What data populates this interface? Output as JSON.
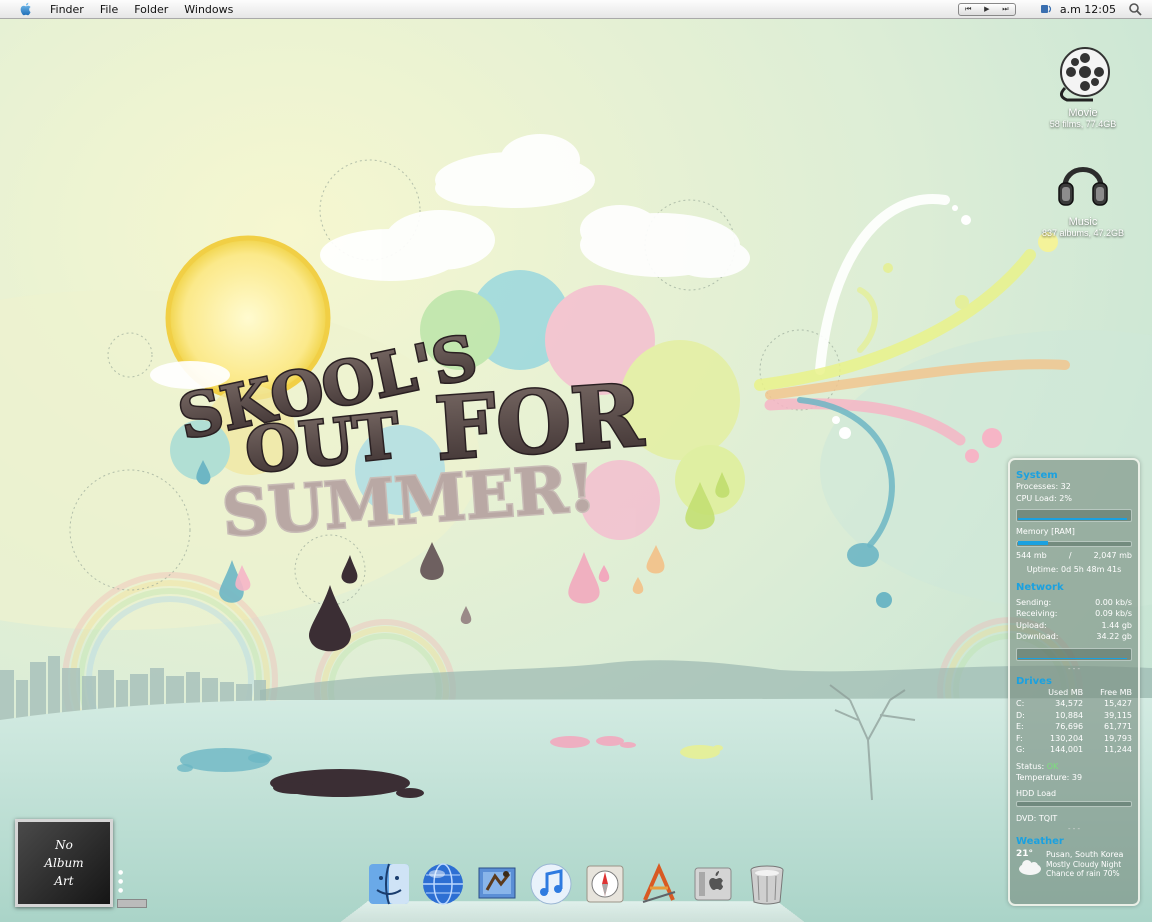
{
  "menubar": {
    "items": [
      "Finder",
      "File",
      "Folder",
      "Windows"
    ],
    "clock": "a.m 12:05",
    "media_controls": [
      "⏮",
      "▶",
      "⏭"
    ]
  },
  "desktop_icons": [
    {
      "label": "Movie",
      "sub": "58 films, 77.4GB",
      "icon": "film-reel-icon"
    },
    {
      "label": "Music",
      "sub": "837 albums, 47.2GB",
      "icon": "headphones-icon"
    }
  ],
  "wallpaper": {
    "words": [
      "SKOOL'S",
      "OUT",
      "FOR",
      "SUMMER!"
    ]
  },
  "sysmon": {
    "system": {
      "title": "System",
      "processes": "Processes: 32",
      "cpu": "CPU Load: 2%"
    },
    "memory": {
      "title": "Memory [RAM]",
      "used": "544 mb",
      "sep": "/",
      "total": "2,047 mb",
      "uptime": "Uptime: 0d 5h 48m 41s"
    },
    "network": {
      "title": "Network",
      "rows": [
        {
          "k": "Sending:",
          "v": "0.00 kb/s"
        },
        {
          "k": "Receiving:",
          "v": "0.09 kb/s"
        },
        {
          "k": "Upload:",
          "v": "1.44 gb"
        },
        {
          "k": "Download:",
          "v": "34.22 gb"
        }
      ]
    },
    "drives": {
      "title": "Drives",
      "headers": [
        "",
        "Used MB",
        "Free MB"
      ],
      "rows": [
        [
          "C:",
          "34,572",
          "15,427"
        ],
        [
          "D:",
          "10,884",
          "39,115"
        ],
        [
          "E:",
          "76,696",
          "61,771"
        ],
        [
          "F:",
          "130,204",
          "19,793"
        ],
        [
          "G:",
          "144,001",
          "11,244"
        ]
      ],
      "status_label": "Status:",
      "status_value": "OK",
      "temperature": "Temperature: 39",
      "hdd_load": "HDD Load",
      "dvd": "DVD: TQIT"
    },
    "weather": {
      "title": "Weather",
      "temp": "21°",
      "location": "Pusan, South Korea",
      "condition": "Mostly Cloudy Night",
      "chance": "Chance of rain 70%"
    },
    "dots": "- - -"
  },
  "album_art": {
    "lines": [
      "No",
      "Album",
      "Art"
    ]
  },
  "dock": {
    "items": [
      "finder-icon",
      "network-globe-icon",
      "mail-icon",
      "itunes-icon",
      "safari-icon",
      "app-store-icon",
      "system-preferences-icon",
      "trash-icon"
    ]
  },
  "colors": {
    "accent": "#1ba1e0",
    "ok": "#7be07b"
  }
}
